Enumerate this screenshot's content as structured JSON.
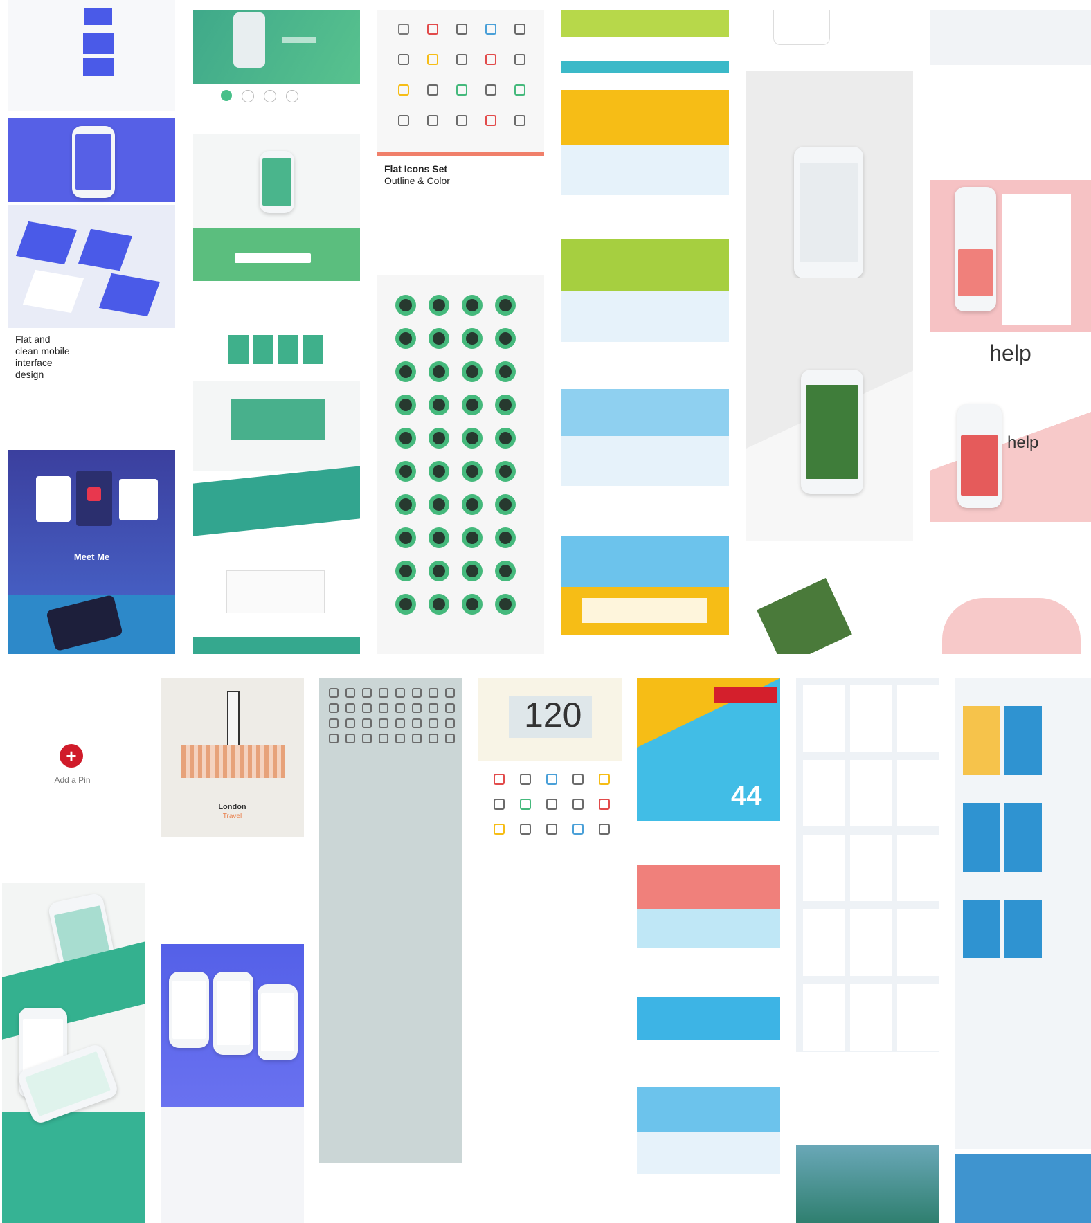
{
  "board": {
    "add_pin_label": "Add a Pin",
    "add_pin_symbol": "+"
  },
  "pins": {
    "p1": {
      "title_lines": [
        "Flat and",
        "clean mobile",
        "interface",
        "design"
      ]
    },
    "p1b": {
      "title": "Meet Me"
    },
    "p3": {
      "title_lines": [
        "Flat Icons Set",
        "Outline & Color"
      ]
    },
    "p6": {
      "title": "help"
    },
    "p6b": {
      "title": "help"
    },
    "p10": {
      "title": "120"
    },
    "p11": {
      "title": "44"
    },
    "p14": {
      "title": "London",
      "subtitle": "Travel"
    }
  },
  "colors": {
    "pinterest_red": "#d01b2a",
    "indigo": "#5660e6",
    "teal": "#4ab58c",
    "green_avatar": "#45b97c",
    "yellow": "#f6bd16",
    "sky": "#3db4e5",
    "lime": "#a6cf40",
    "salmon": "#f0807b",
    "pink": "#f7c9c9",
    "blue_app": "#2f93d1"
  }
}
